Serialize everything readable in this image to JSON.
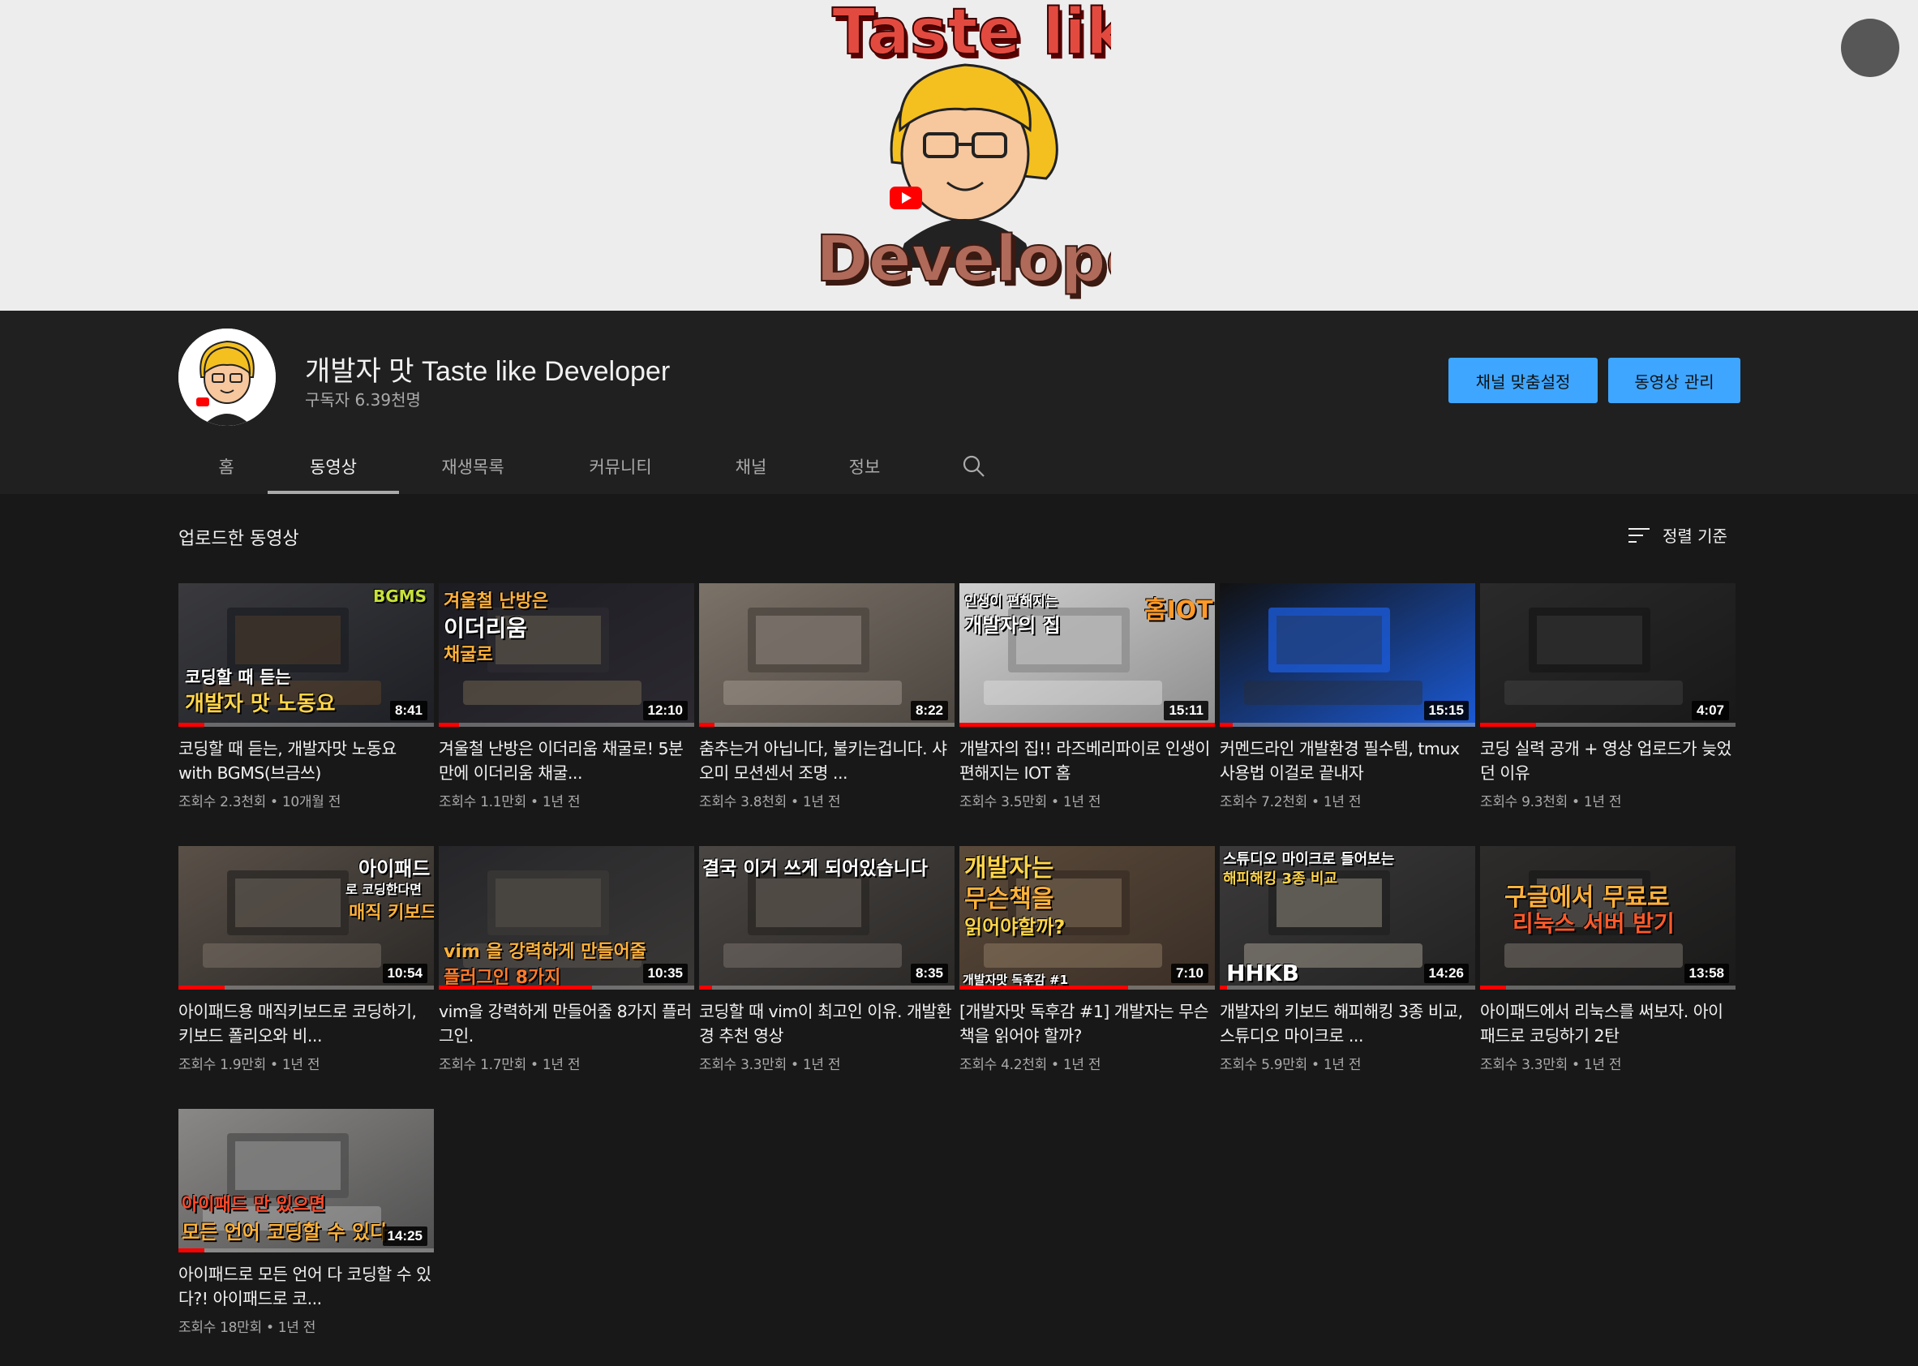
{
  "banner": {
    "line1": "Taste like",
    "line2": "Developer"
  },
  "channel": {
    "name": "개발자 맛 Taste like Developer",
    "subscribers": "구독자 6.39천명",
    "customize_label": "채널 맞춤설정",
    "manage_label": "동영상 관리"
  },
  "tabs": [
    {
      "label": "홈"
    },
    {
      "label": "동영상",
      "active": true
    },
    {
      "label": "재생목록"
    },
    {
      "label": "커뮤니티"
    },
    {
      "label": "채널"
    },
    {
      "label": "정보"
    }
  ],
  "section": {
    "title": "업로드한 동영상",
    "sort_label": "정렬 기준"
  },
  "videos": [
    {
      "title": "코딩할 때 듣는, 개발자맛 노동요 with BGMS(브금쓰)",
      "meta": "조회수 2.3천회 • 10개월 전",
      "duration": "8:41",
      "progress": 0.1,
      "overlay": [
        "코딩할 때 듣는",
        "개발자 맛 노동요",
        "BGMS"
      ]
    },
    {
      "title": "겨울철 난방은 이더리움 채굴로! 5분만에 이더리움 채굴...",
      "meta": "조회수 1.1만회 • 1년 전",
      "duration": "12:10",
      "progress": 0.08,
      "overlay": [
        "겨울철 난방은",
        "이더리움",
        "채굴로"
      ]
    },
    {
      "title": "춤추는거 아닙니다, 불키는겁니다. 샤오미 모션센서 조명 ...",
      "meta": "조회수 3.8천회 • 1년 전",
      "duration": "8:22",
      "progress": 0.06,
      "overlay": []
    },
    {
      "title": "개발자의 집!! 라즈베리파이로 인생이 편해지는 IOT 홈",
      "meta": "조회수 3.5만회 • 1년 전",
      "duration": "15:11",
      "progress": 1.0,
      "overlay": [
        "인생이 편해지는",
        "개발자의 집",
        "홈IOT"
      ]
    },
    {
      "title": "커멘드라인 개발환경 필수템, tmux 사용법 이걸로 끝내자",
      "meta": "조회수 7.2천회 • 1년 전",
      "duration": "15:15",
      "progress": 0.05,
      "overlay": []
    },
    {
      "title": "코딩 실력 공개 + 영상 업로드가 늦었던 이유",
      "meta": "조회수 9.3천회 • 1년 전",
      "duration": "4:07",
      "progress": 0.22,
      "overlay": []
    },
    {
      "title": "아이패드용 매직키보드로 코딩하기, 키보드 폴리오와 비...",
      "meta": "조회수 1.9만회 • 1년 전",
      "duration": "10:54",
      "progress": 0.18,
      "overlay": [
        "아이패드",
        "로 코딩한다면",
        "매직 키보드"
      ]
    },
    {
      "title": "vim을 강력하게 만들어줄 8가지 플러그인.",
      "meta": "조회수 1.7만회 • 1년 전",
      "duration": "10:35",
      "progress": 0.6,
      "overlay": [
        "vim 을 강력하게 만들어줄",
        "플러그인 8가지"
      ]
    },
    {
      "title": "코딩할 때 vim이 최고인 이유. 개발환경 추천 영상",
      "meta": "조회수 3.3만회 • 1년 전",
      "duration": "8:35",
      "progress": 0.05,
      "overlay": [
        "결국 이거 쓰게 되어있습니다"
      ]
    },
    {
      "title": "[개발자맛 독후감 #1] 개발자는 무슨 책을 읽어야 할까?",
      "meta": "조회수 4.2천회 • 1년 전",
      "duration": "7:10",
      "progress": 0.66,
      "overlay": [
        "개발자는",
        "무슨책을",
        "읽어야할까?",
        "개발자맛 독후감 #1"
      ]
    },
    {
      "title": "개발자의 키보드 해피해킹 3종 비교, 스튜디오 마이크로 ...",
      "meta": "조회수 5.9만회 • 1년 전",
      "duration": "14:26",
      "progress": 0.03,
      "overlay": [
        "스튜디오 마이크로 들어보는",
        "해피해킹 3종 비교",
        "HHKB"
      ]
    },
    {
      "title": "아이패드에서 리눅스를 써보자. 아이패드로 코딩하기 2탄",
      "meta": "조회수 3.3만회 • 1년 전",
      "duration": "13:58",
      "progress": 0.1,
      "overlay": [
        "구글에서 무료로",
        "리눅스 서버 받기"
      ]
    },
    {
      "title": "아이패드로 모든 언어 다 코딩할 수 있다?! 아이패드로 코...",
      "meta": "조회수 18만회 • 1년 전",
      "duration": "14:25",
      "progress": 0.1,
      "overlay": [
        "아이패드 만 있으면",
        "모든 언어 코딩할 수 있다"
      ]
    }
  ]
}
